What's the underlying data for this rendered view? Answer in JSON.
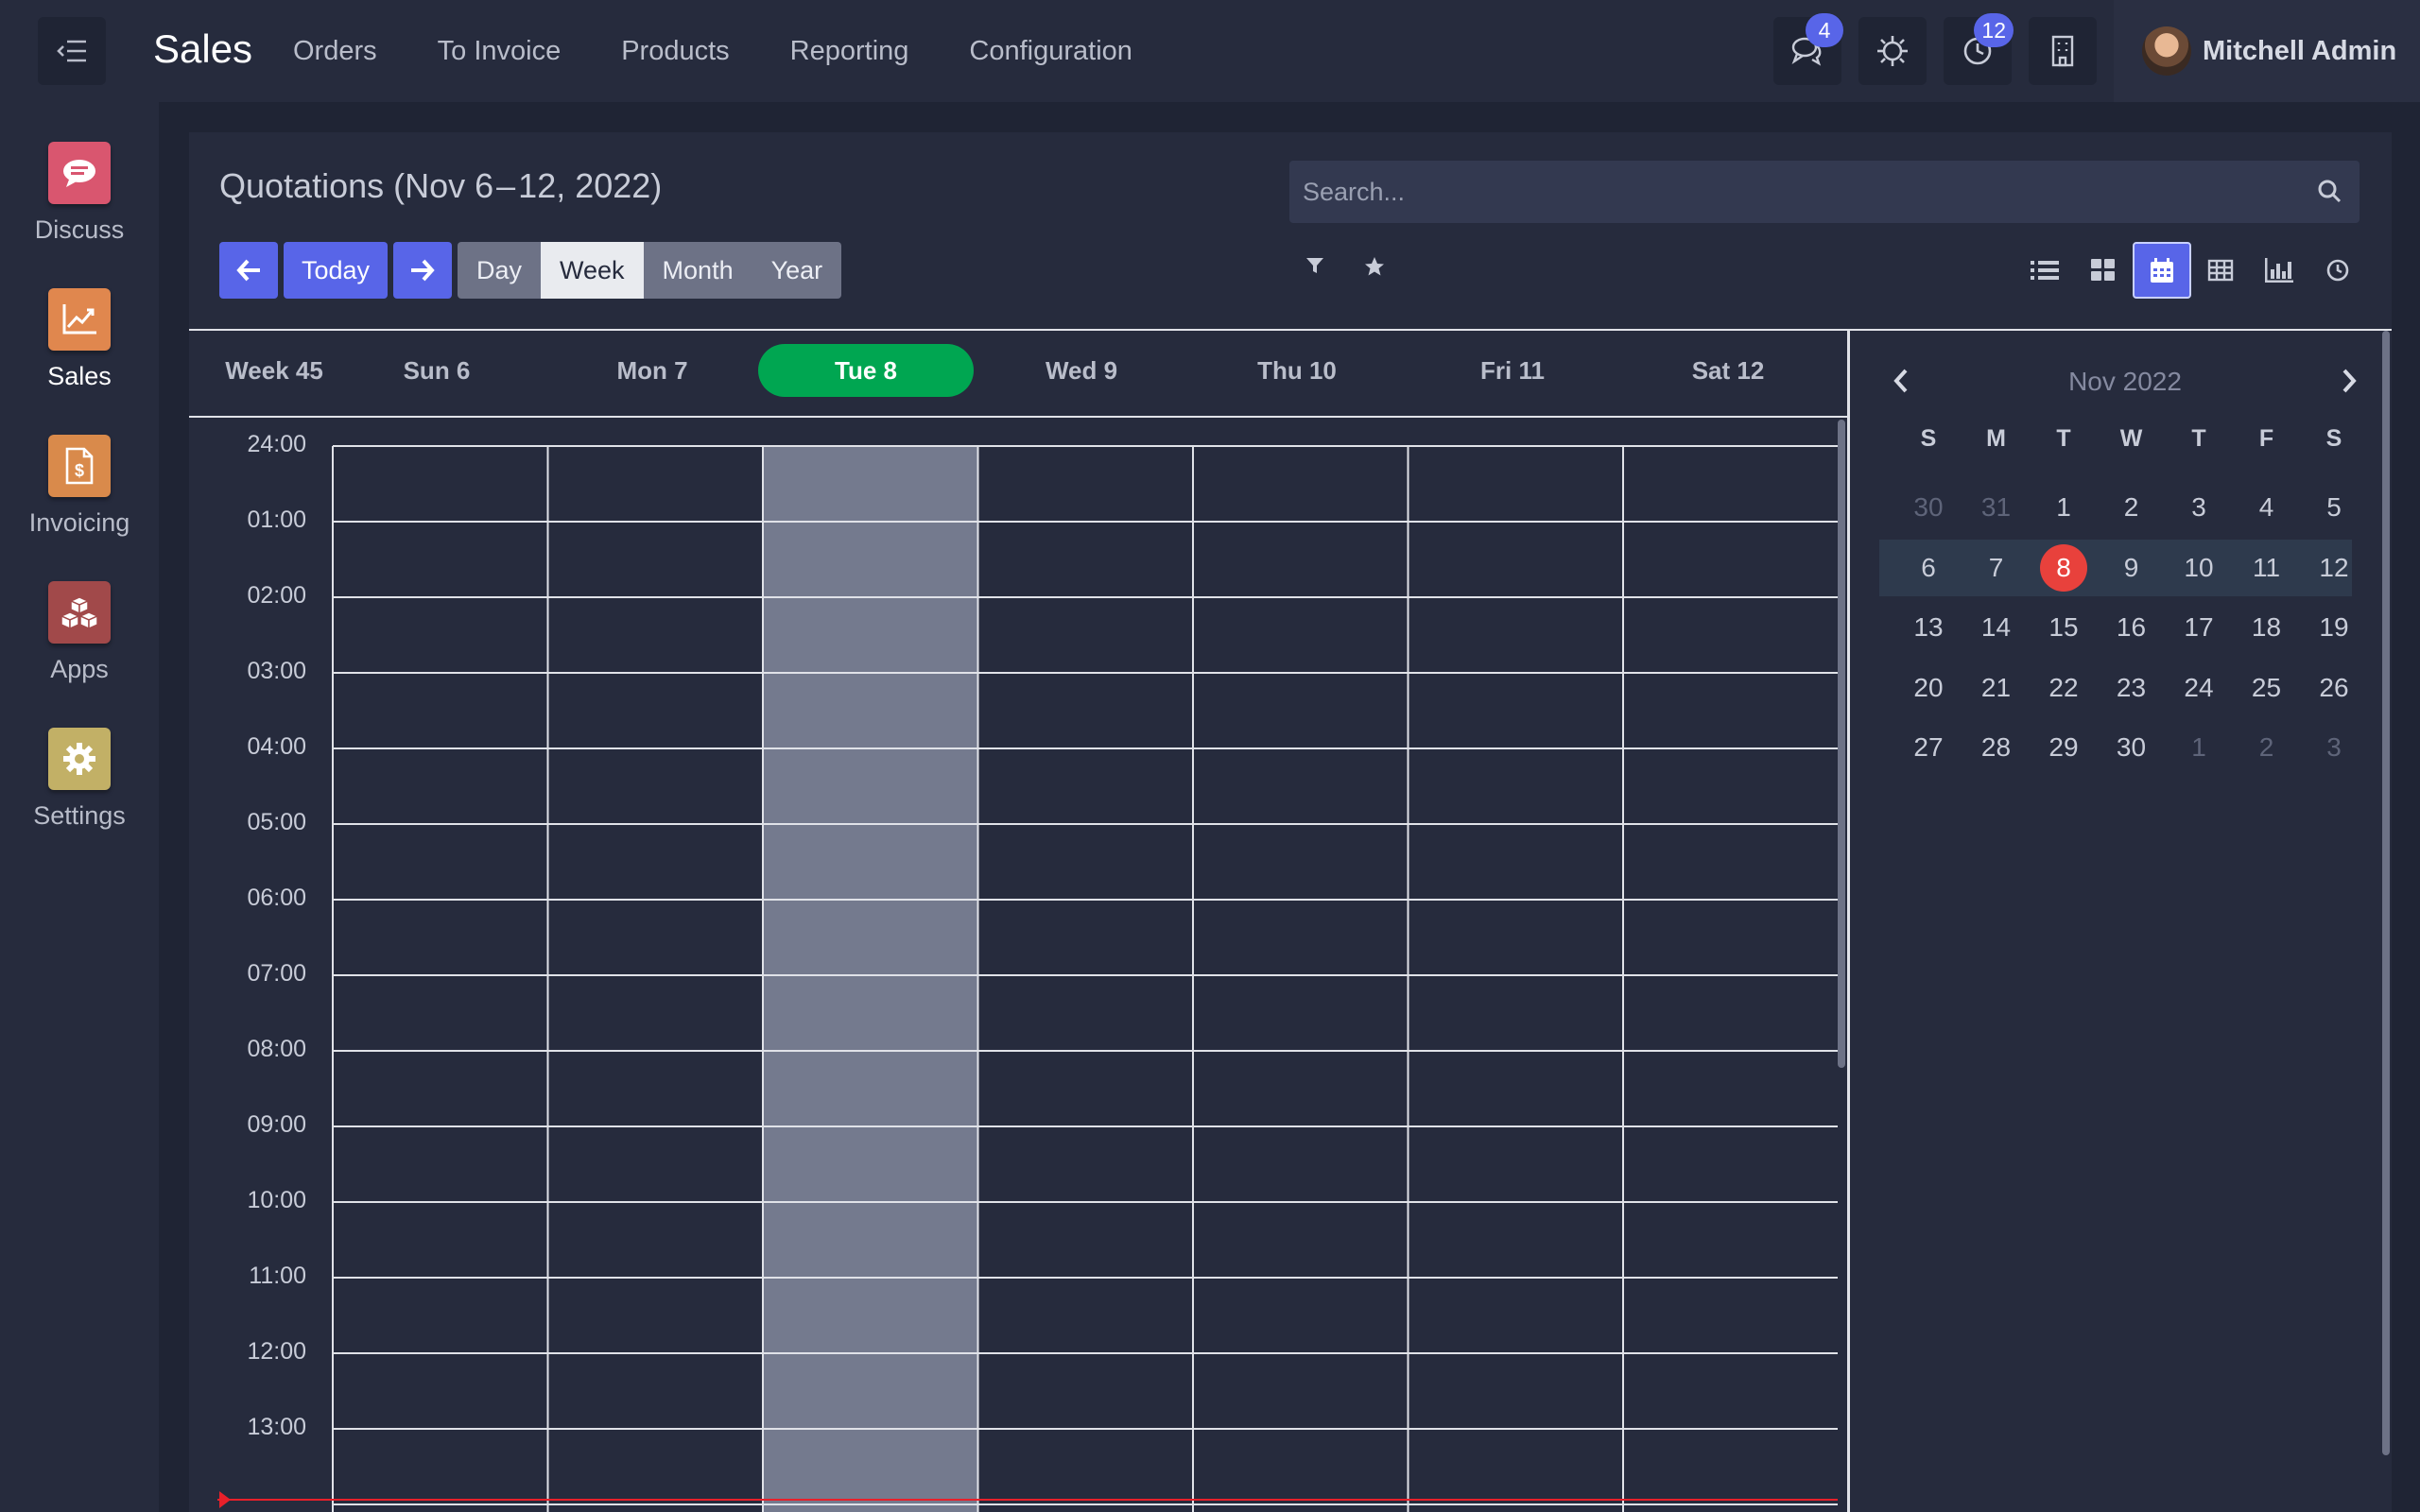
{
  "navbar": {
    "app_title": "Sales",
    "menu": [
      "Orders",
      "To Invoice",
      "Products",
      "Reporting",
      "Configuration"
    ],
    "chat_badge": "4",
    "activity_badge": "12",
    "user_name": "Mitchell Admin"
  },
  "sidebar": {
    "items": [
      {
        "label": "Discuss",
        "color": "#d9566f"
      },
      {
        "label": "Sales",
        "color": "#e0874e"
      },
      {
        "label": "Invoicing",
        "color": "#d98a4b"
      },
      {
        "label": "Apps",
        "color": "#a1494a"
      },
      {
        "label": "Settings",
        "color": "#c2b066"
      }
    ]
  },
  "main": {
    "title": "Quotations (Nov 6 – 12, 2022)",
    "search_placeholder": "Search...",
    "today_label": "Today",
    "scales": [
      "Day",
      "Week",
      "Month",
      "Year"
    ],
    "active_scale": "Week"
  },
  "calendar": {
    "week_label": "Week 45",
    "days": [
      "Sun 6",
      "Mon 7",
      "Tue 8",
      "Wed 9",
      "Thu 10",
      "Fri 11",
      "Sat 12"
    ],
    "today_index": 2,
    "hours": [
      "24:00",
      "01:00",
      "02:00",
      "03:00",
      "04:00",
      "05:00",
      "06:00",
      "07:00",
      "08:00",
      "09:00",
      "10:00",
      "11:00",
      "12:00",
      "13:00"
    ]
  },
  "mini_calendar": {
    "title": "Nov 2022",
    "weekdays": [
      "S",
      "M",
      "T",
      "W",
      "T",
      "F",
      "S"
    ],
    "weeks": [
      [
        "30",
        "31",
        "1",
        "2",
        "3",
        "4",
        "5"
      ],
      [
        "6",
        "7",
        "8",
        "9",
        "10",
        "11",
        "12"
      ],
      [
        "13",
        "14",
        "15",
        "16",
        "17",
        "18",
        "19"
      ],
      [
        "20",
        "21",
        "22",
        "23",
        "24",
        "25",
        "26"
      ],
      [
        "27",
        "28",
        "29",
        "30",
        "1",
        "2",
        "3"
      ]
    ],
    "today": "8"
  },
  "colors": {
    "accent": "#5865e8",
    "today_header": "#00a651",
    "today_dot": "#e8413c",
    "now_line": "#e8202a"
  }
}
